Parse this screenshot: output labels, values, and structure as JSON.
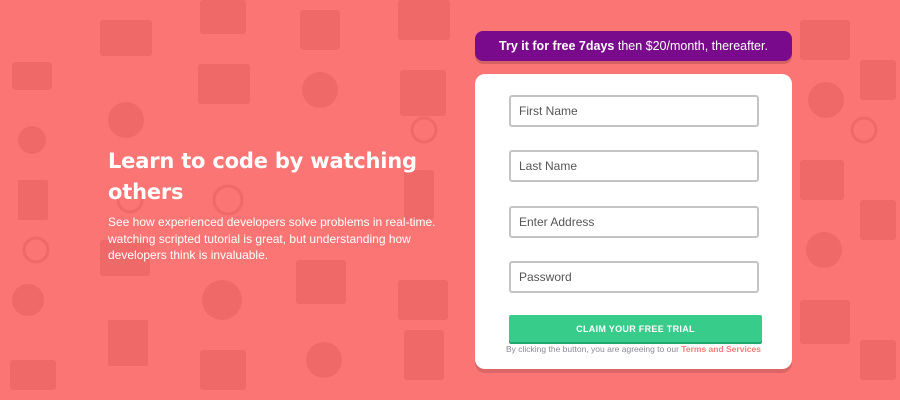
{
  "hero": {
    "title": "Learn to code by watching others",
    "description": "See how experienced developers solve problems in real-time. watching scripted tutorial is great, but understanding how developers think is invaluable."
  },
  "trial_banner": {
    "highlight": "Try it for free 7days",
    "rest": " then $20/month, thereafter."
  },
  "form": {
    "first_name_placeholder": "First Name",
    "last_name_placeholder": "Last Name",
    "address_placeholder": "Enter Address",
    "password_placeholder": "Password",
    "submit_label": "CLAIM YOUR FREE TRIAL",
    "terms_prefix": "By clicking the button, you are agreeing to our ",
    "terms_link": "Terms and Services"
  },
  "colors": {
    "background": "#fb7575",
    "banner": "#7a0a8c",
    "button": "#38cc8b",
    "terms_link": "#ff7a7a"
  }
}
